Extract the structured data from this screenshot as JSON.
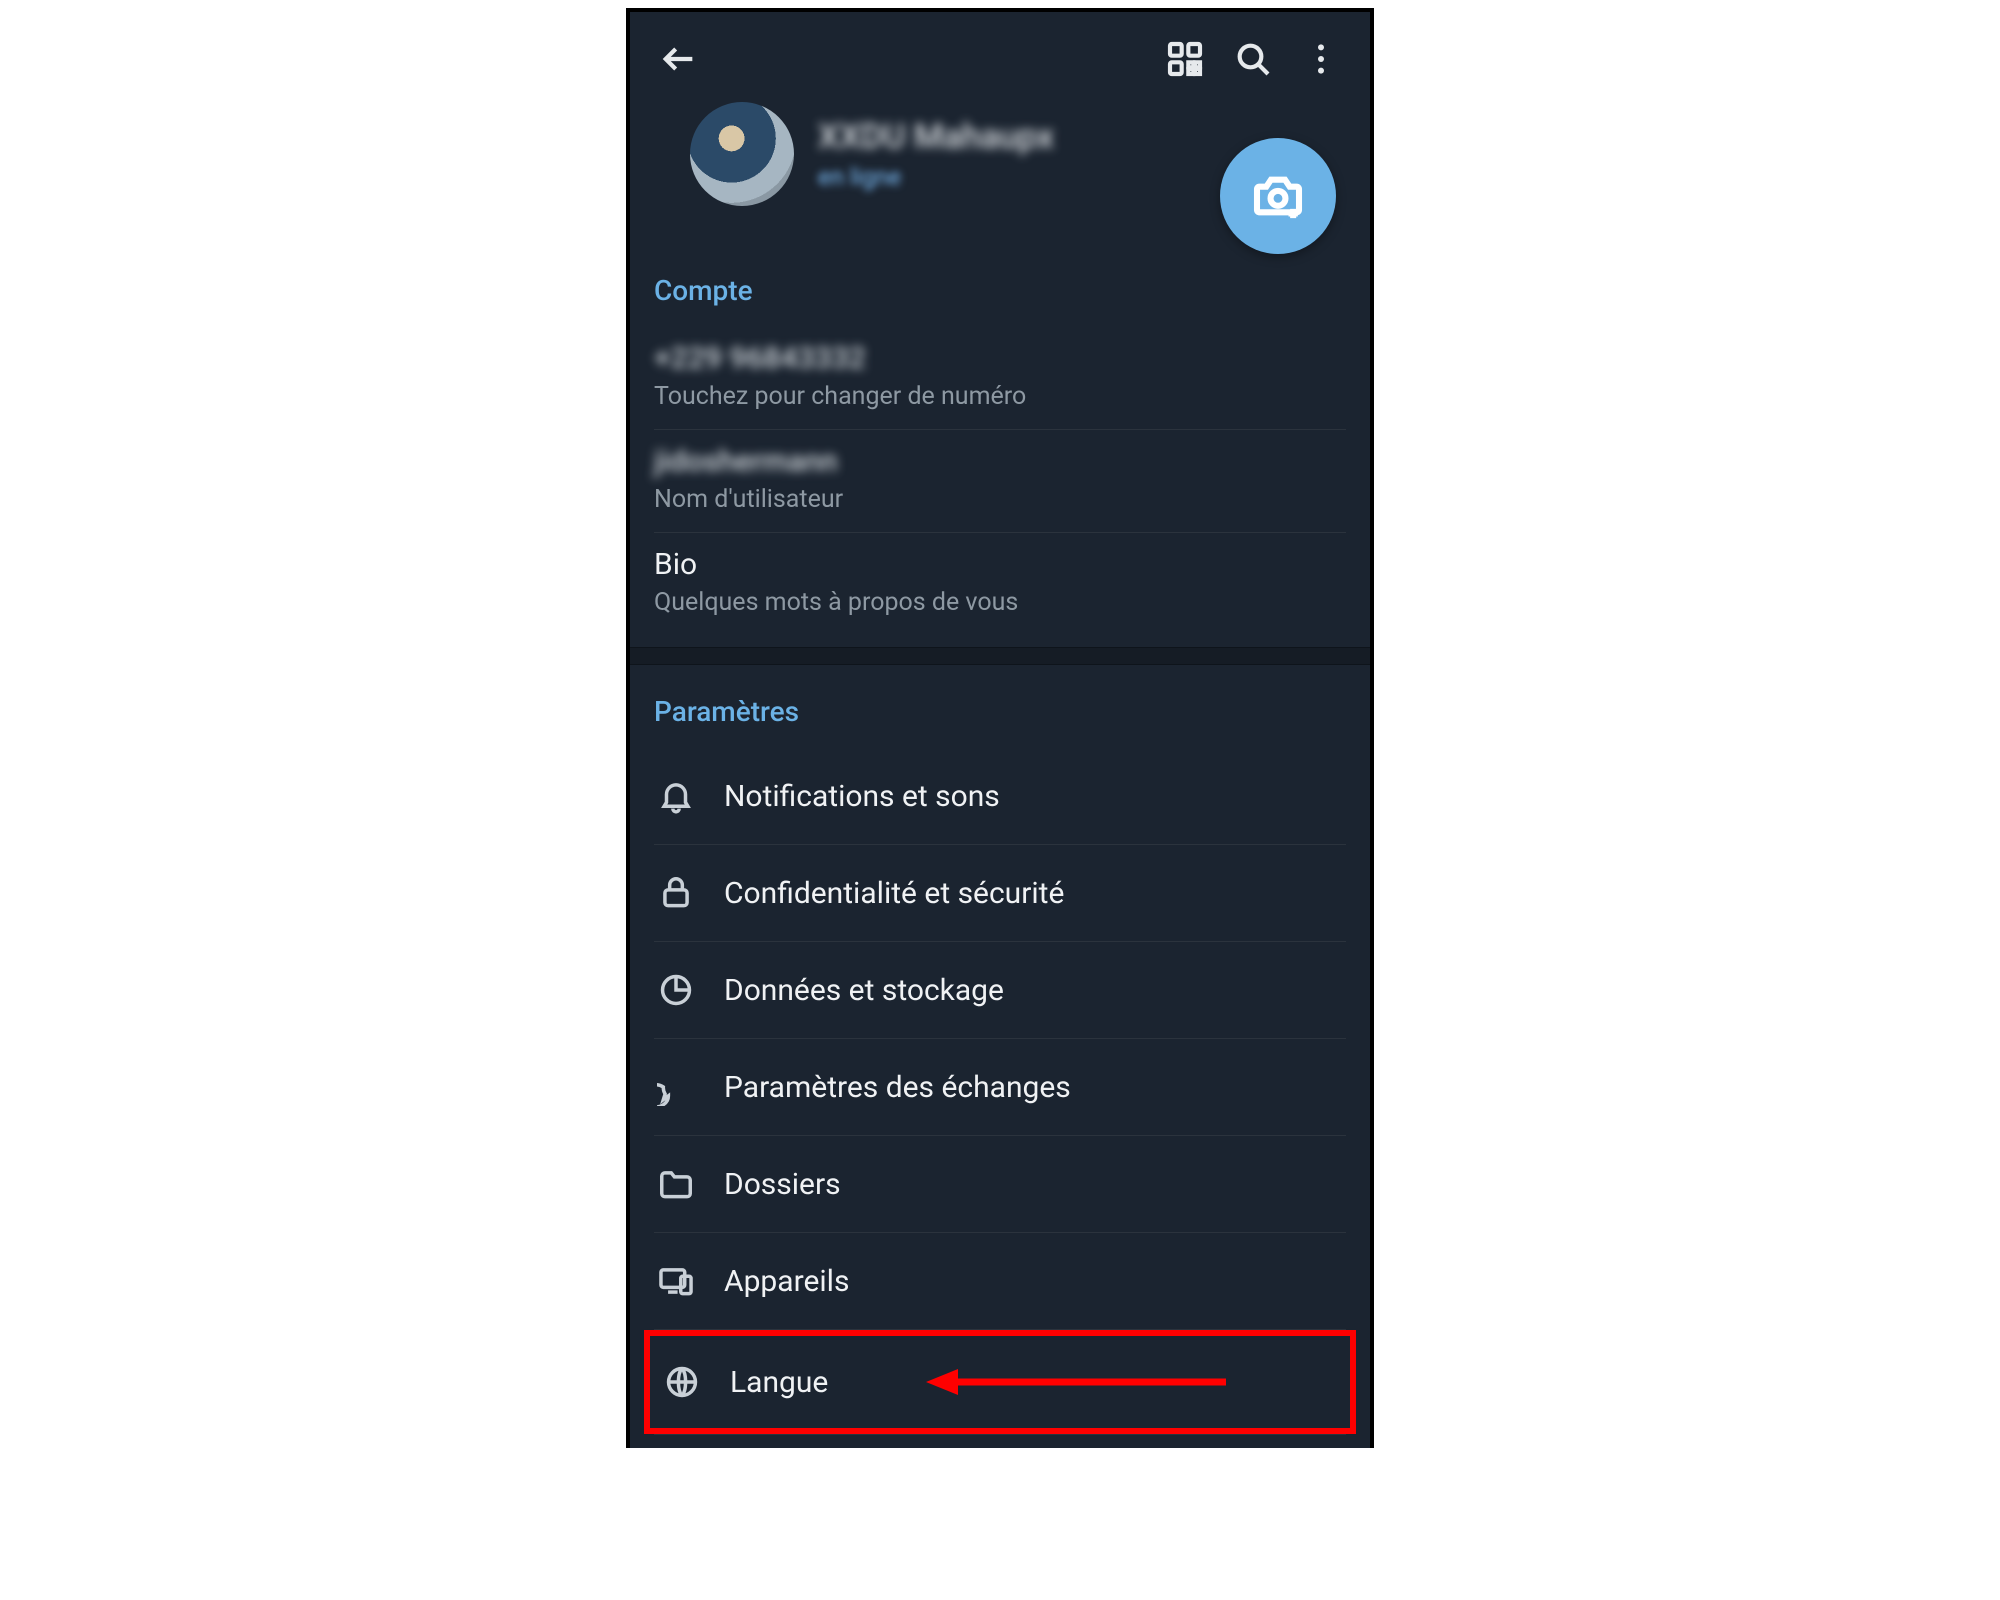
{
  "header": {
    "back": "←",
    "profile_name": "XXDU  Mahaupx",
    "profile_status": "en ligne"
  },
  "account": {
    "section_title": "Compte",
    "phone_value": "+229 96843332",
    "phone_sub": "Touchez pour changer de numéro",
    "username_value": "jidoshermann",
    "username_sub": "Nom d'utilisateur",
    "bio_title": "Bio",
    "bio_sub": "Quelques mots à propos de vous"
  },
  "settings": {
    "section_title": "Paramètres",
    "items": [
      {
        "label": "Notifications et sons"
      },
      {
        "label": "Confidentialité et sécurité"
      },
      {
        "label": "Données et stockage"
      },
      {
        "label": "Paramètres des échanges"
      },
      {
        "label": "Dossiers"
      },
      {
        "label": "Appareils"
      },
      {
        "label": "Langue"
      }
    ]
  }
}
